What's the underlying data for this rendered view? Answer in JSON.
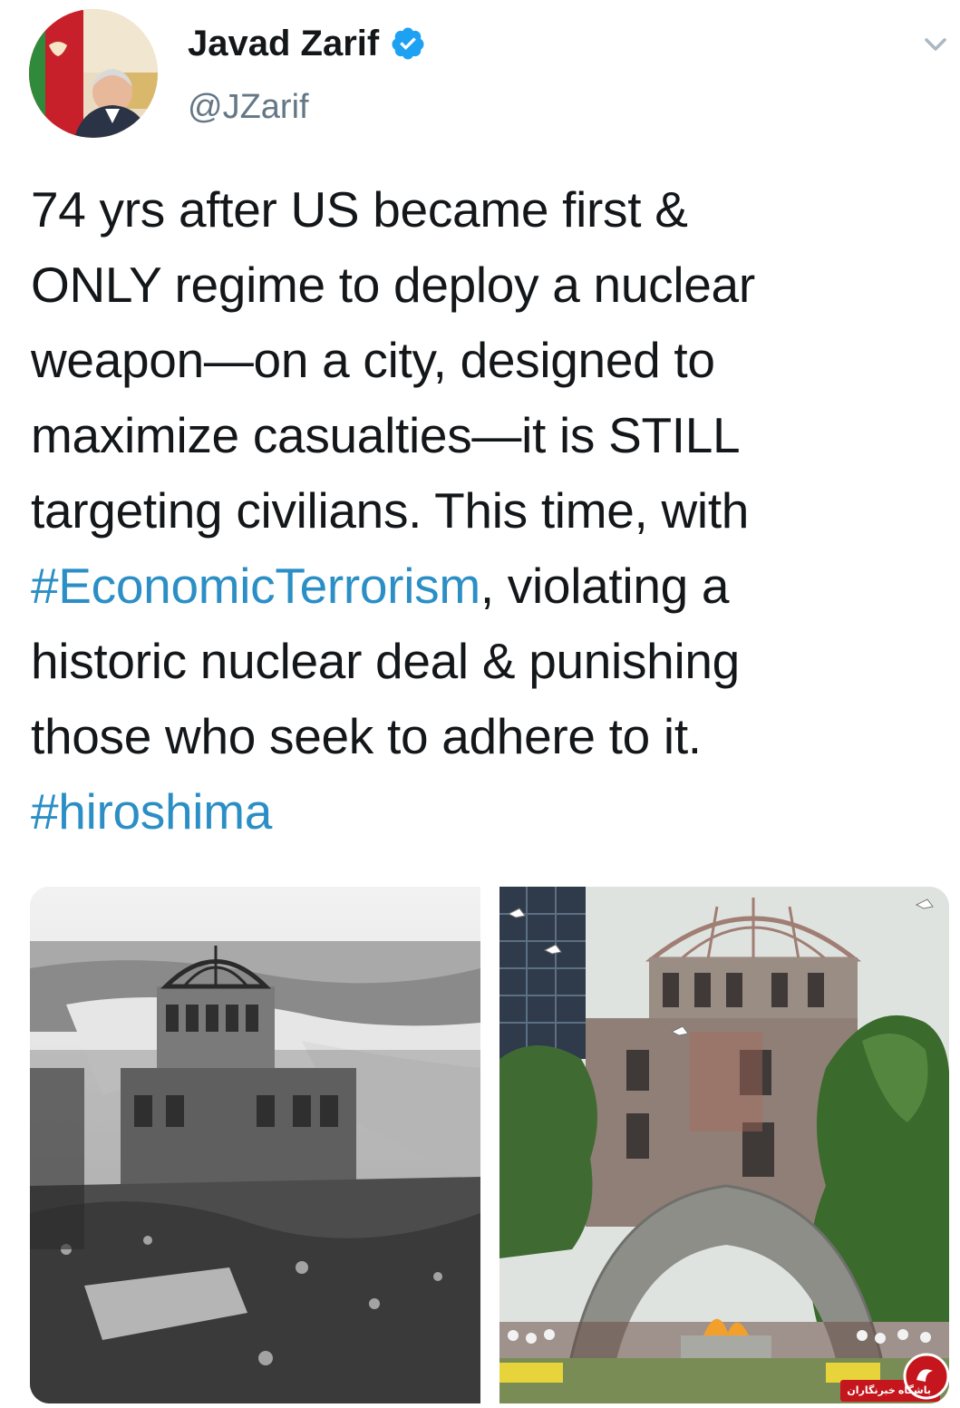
{
  "author": {
    "name": "Javad Zarif",
    "handle": "@JZarif",
    "verified": true,
    "avatar_icon": "profile-photo"
  },
  "menu_icon": "chevron-down-icon",
  "tweet": {
    "lines": [
      [
        {
          "t": "74 yrs after US became first &",
          "hashtag": false
        }
      ],
      [
        {
          "t": "ONLY regime to deploy a nuclear",
          "hashtag": false
        }
      ],
      [
        {
          "t": "weapon—on a city, designed to",
          "hashtag": false
        }
      ],
      [
        {
          "t": "maximize casualties—it is STILL",
          "hashtag": false
        }
      ],
      [
        {
          "t": "targeting civilians. This time, with",
          "hashtag": false
        }
      ],
      [
        {
          "t": "#EconomicTerrorism",
          "hashtag": true
        },
        {
          "t": ", violating a",
          "hashtag": false
        }
      ],
      [
        {
          "t": "historic nuclear deal & punishing",
          "hashtag": false
        }
      ],
      [
        {
          "t": "those who seek to adhere to it.",
          "hashtag": false
        }
      ],
      [
        {
          "t": "#hiroshima",
          "hashtag": true
        }
      ]
    ]
  },
  "media": [
    {
      "name": "hiroshima-ruins-photo"
    },
    {
      "name": "hiroshima-memorial-photo"
    }
  ],
  "watermark": {
    "text": "باشگاه خبرنگاران"
  },
  "colors": {
    "hashtag": "#2b8fc6",
    "verified": "#1da1f2",
    "handle": "#657786",
    "watermark": "#c4161c"
  }
}
